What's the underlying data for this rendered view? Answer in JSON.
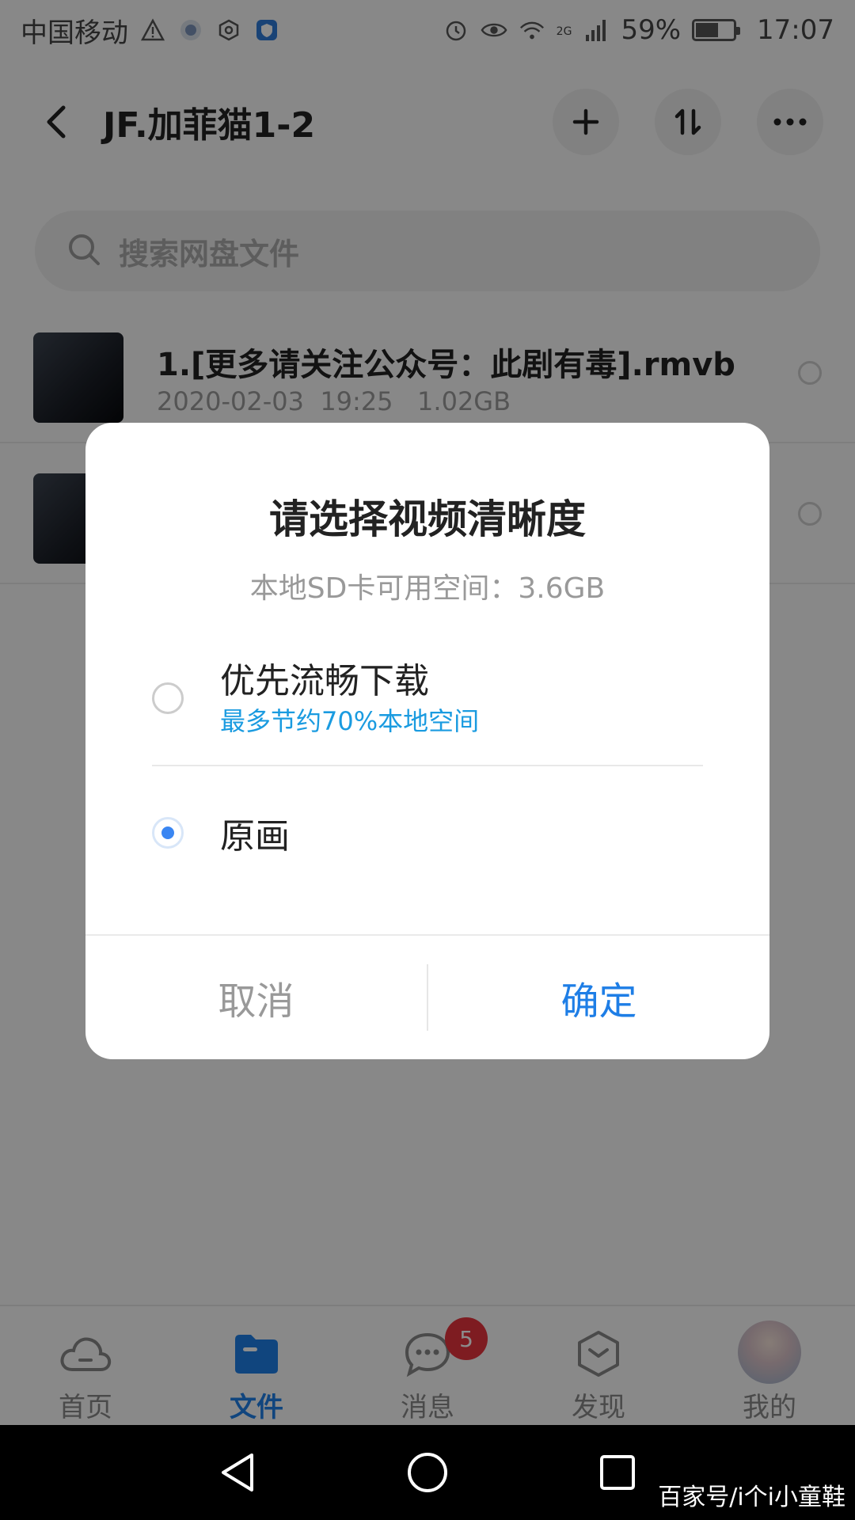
{
  "status_bar": {
    "carrier": "中国移动",
    "network": "2G",
    "battery": "59%",
    "time": "17:07"
  },
  "header": {
    "title": "JF.加菲猫1-2",
    "icons": [
      "back-arrow-icon",
      "plus-icon",
      "sort-icon",
      "more-icon"
    ]
  },
  "search": {
    "placeholder": "搜索网盘文件"
  },
  "files": [
    {
      "name": "1.[更多请关注公众号：此剧有毒].rmvb",
      "date": "2020-02-03",
      "time": "19:25",
      "size": "1.02GB"
    },
    {
      "name": "",
      "date": "",
      "time": "",
      "size": ""
    }
  ],
  "dialog": {
    "title": "请选择视频清晰度",
    "subtitle": "本地SD卡可用空间：3.6GB",
    "options": [
      {
        "label": "优先流畅下载",
        "desc": "最多节约70%本地空间",
        "selected": false
      },
      {
        "label": "原画",
        "desc": "",
        "selected": true
      }
    ],
    "cancel_label": "取消",
    "confirm_label": "确定",
    "accent_color": "#1e7ee6"
  },
  "bottom_nav": {
    "items": [
      {
        "label": "首页",
        "icon": "cloud-icon",
        "active": false
      },
      {
        "label": "文件",
        "icon": "folder-icon",
        "active": true
      },
      {
        "label": "消息",
        "icon": "chat-icon",
        "active": false,
        "badge": "5"
      },
      {
        "label": "发现",
        "icon": "discover-icon",
        "active": false
      },
      {
        "label": "我的",
        "icon": "avatar",
        "active": false
      }
    ]
  },
  "watermark": "百家号/i个i小童鞋"
}
